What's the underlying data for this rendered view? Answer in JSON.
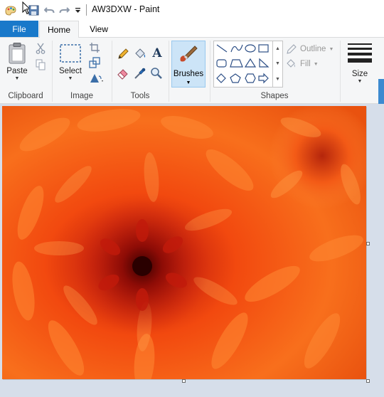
{
  "window": {
    "title": "AW3DXW - Paint"
  },
  "tabs": {
    "file": "File",
    "home": "Home",
    "view": "View"
  },
  "ribbon": {
    "clipboard": {
      "paste": "Paste",
      "group_label": "Clipboard"
    },
    "image": {
      "select": "Select",
      "group_label": "Image"
    },
    "tools": {
      "group_label": "Tools"
    },
    "brushes": {
      "label": "Brushes"
    },
    "shapes": {
      "outline": "Outline",
      "fill": "Fill",
      "group_label": "Shapes"
    },
    "size": {
      "label": "Size"
    }
  },
  "colors": {
    "accent": "#1979ca",
    "ribbon_bg": "#f5f6f7",
    "workspace_bg": "#d6deea"
  },
  "icons": {
    "paint-logo": "paint-logo-icon",
    "save": "save-icon",
    "undo": "undo-icon",
    "redo": "redo-icon",
    "customize": "chevron-down-icon"
  }
}
